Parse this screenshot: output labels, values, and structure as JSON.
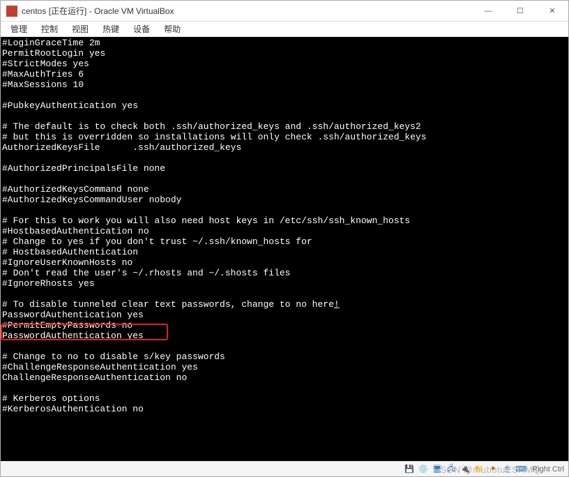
{
  "window": {
    "title": "centos [正在运行] - Oracle VM VirtualBox"
  },
  "menu": {
    "items": [
      "管理",
      "控制",
      "视图",
      "热键",
      "设备",
      "帮助"
    ]
  },
  "terminal": {
    "lines": [
      "#LoginGraceTime 2m",
      "PermitRootLogin yes",
      "#StrictModes yes",
      "#MaxAuthTries 6",
      "#MaxSessions 10",
      "",
      "#PubkeyAuthentication yes",
      "",
      "# The default is to check both .ssh/authorized_keys and .ssh/authorized_keys2",
      "# but this is overridden so installations will only check .ssh/authorized_keys",
      "AuthorizedKeysFile      .ssh/authorized_keys",
      "",
      "#AuthorizedPrincipalsFile none",
      "",
      "#AuthorizedKeysCommand none",
      "#AuthorizedKeysCommandUser nobody",
      "",
      "# For this to work you will also need host keys in /etc/ssh/ssh_known_hosts",
      "#HostbasedAuthentication no",
      "# Change to yes if you don't trust ~/.ssh/known_hosts for",
      "# HostbasedAuthentication",
      "#IgnoreUserKnownHosts no",
      "# Don't read the user's ~/.rhosts and ~/.shosts files",
      "#IgnoreRhosts yes",
      "",
      "# To disable tunneled clear text passwords, change to no here!",
      "PasswordAuthentication yes",
      "#PermitEmptyPasswords no",
      "PasswordAuthentication yes",
      "",
      "# Change to no to disable s/key passwords",
      "#ChallengeResponseAuthentication yes",
      "ChallengeResponseAuthentication no",
      "",
      "# Kerberos options",
      "#KerberosAuthentication no"
    ],
    "highlight_line_index": 28,
    "cursor_line_index": 25
  },
  "status": {
    "right_ctrl": "Right Ctrl",
    "watermark": "CSDN @mubotuESRMQ"
  },
  "icons": {
    "vm": "vm-icon",
    "min": "—",
    "max": "☐",
    "close": "✕",
    "disk": "💾",
    "optical": "💿",
    "net": "🖧",
    "usb": "🔌",
    "shared": "📁",
    "display": "🖥",
    "record": "⏺",
    "mouse": "🖱",
    "kbd": "⌨"
  }
}
